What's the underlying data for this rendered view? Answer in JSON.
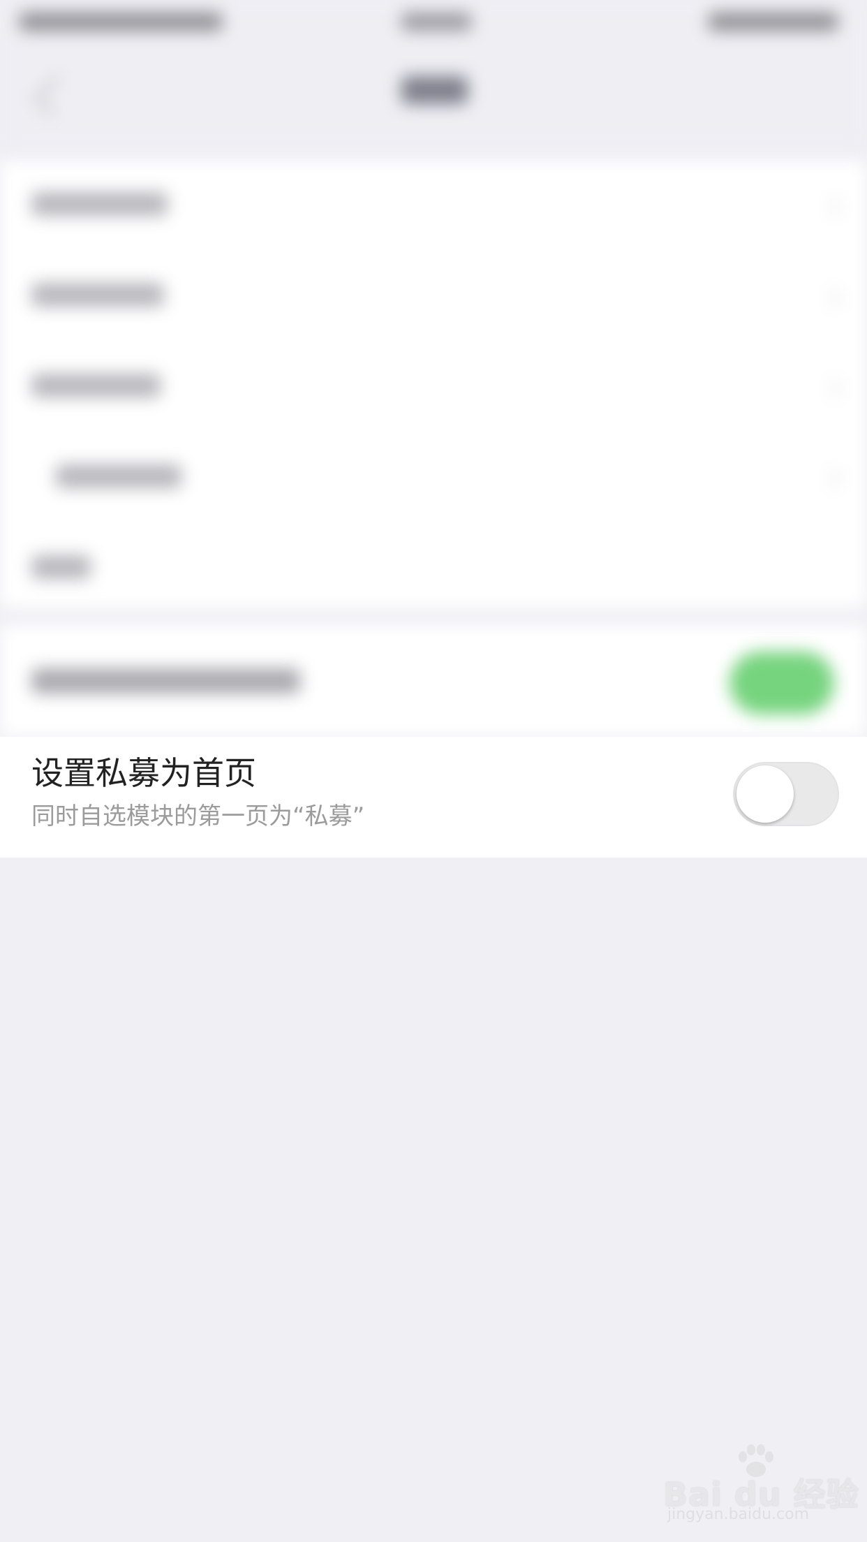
{
  "setting": {
    "title": "设置私募为首页",
    "subtitle": "同时自选模块的第一页为“私募”",
    "toggle_state": "off"
  },
  "watermark": {
    "brand": "Bai du 经验",
    "url": "jingyan.baidu.com",
    "icon": "paw-icon"
  },
  "colors": {
    "toggle_on_green": "#76d47e",
    "toggle_off_track": "#e9e9ea",
    "page_background": "#efeff4"
  }
}
